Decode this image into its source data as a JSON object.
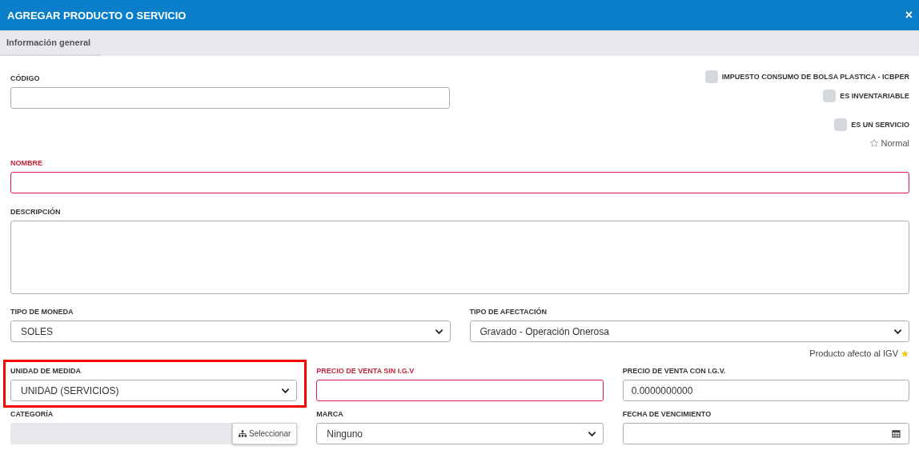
{
  "modal": {
    "title": "AGREGAR PRODUCTO O SERVICIO",
    "close": "×"
  },
  "tabs": [
    {
      "label": "Información general",
      "selected": true
    }
  ],
  "codigo": {
    "label": "CÓDIGO"
  },
  "options": [
    {
      "label": "IMPUESTO CONSUMO DE BOLSA PLASTICA - ICBPER",
      "checked": false
    },
    {
      "label": "ES INVENTARIABLE",
      "checked": false
    },
    {
      "label": "ES UN SERVICIO",
      "checked": false
    }
  ],
  "priority": {
    "label": "Normal"
  },
  "nombre": {
    "label": "NOMBRE",
    "required": true
  },
  "descripcion": {
    "label": "DESCRIPCIÓN",
    "required": false
  },
  "row_currency": [
    {
      "label": "TIPO DE MONEDA",
      "kind": "select",
      "value": "SOLES",
      "required": false,
      "highlighted": false
    },
    {
      "label": "TIPO DE AFECTACIÓN",
      "kind": "select",
      "value": "Gravado - Operación Onerosa",
      "required": false,
      "highlighted": false
    }
  ],
  "igv_note": "Producto afecto al IGV",
  "row_prices": [
    {
      "label": "UNIDAD DE MEDIDA",
      "kind": "select",
      "value": "UNIDAD (SERVICIOS)",
      "required": false,
      "highlighted": true
    },
    {
      "label": "PRECIO DE VENTA SIN I.G.V",
      "kind": "input",
      "required": true,
      "highlighted": false
    },
    {
      "label": "PRECIO DE VENTA CON I.G.V.",
      "kind": "input",
      "value": "0.0000000000",
      "required": false,
      "highlighted": false
    }
  ],
  "row_details": [
    {
      "label": "CATEGORÍA",
      "kind": "picker",
      "button": "Seleccionar",
      "required": false,
      "highlighted": false
    },
    {
      "label": "MARCA",
      "kind": "select",
      "value": "Ninguno",
      "required": false,
      "highlighted": false
    },
    {
      "label": "FECHA DE VENCIMIENTO",
      "kind": "date",
      "required": false,
      "highlighted": false
    }
  ]
}
